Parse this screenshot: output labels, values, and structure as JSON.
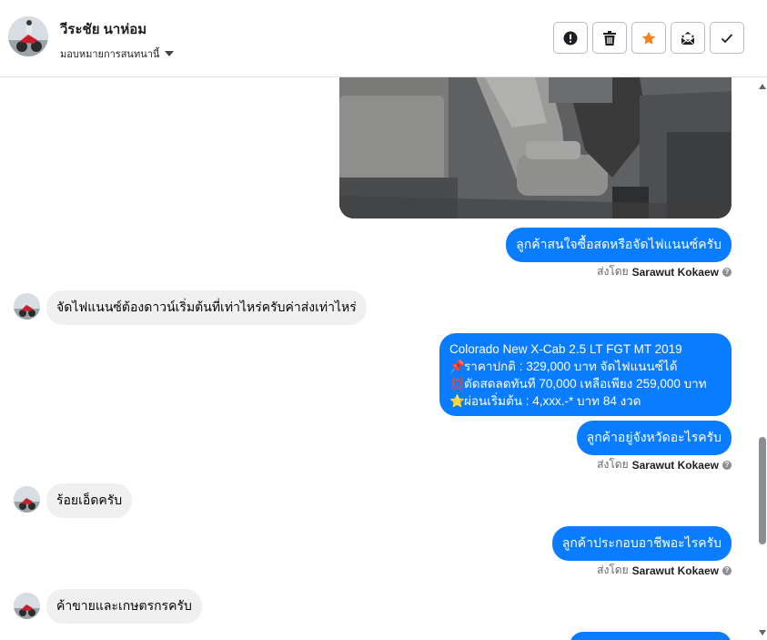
{
  "header": {
    "contact_name": "วีระชัย นาห่อม",
    "assign_label": "มอบหมายการสนทนานี้",
    "actions": [
      {
        "name": "report-button",
        "icon": "exclamation-circle-icon"
      },
      {
        "name": "delete-button",
        "icon": "trash-icon"
      },
      {
        "name": "star-button",
        "icon": "star-icon"
      },
      {
        "name": "mark-unread-button",
        "icon": "envelope-icon"
      },
      {
        "name": "mark-done-button",
        "icon": "check-icon"
      }
    ]
  },
  "colors": {
    "accent_blue": "#0a7cff",
    "star_orange": "#f5821f",
    "incoming_bubble": "#f0f0f0"
  },
  "messages": {
    "m1": {
      "text": "ลูกค้าสนใจซื้อสดหรือจัดไฟแนนซ์ครับ"
    },
    "sent1": {
      "prefix": "ส่งโดย",
      "name": "Sarawut Kokaew"
    },
    "m2": {
      "text": "จัดไฟแนนซ์ต้องดาวน์เริ่มต้นที่เท่าไหร่ครับค่าส่งเท่าไหร่"
    },
    "m3": {
      "line1": "Colorado New X-Cab 2.5 LT FGT MT 2019",
      "line2": "ราคาปกติ : 329,000 บาท จัดไฟแนนซ์ได้",
      "line3": "ตัดสดลดทันที 70,000 เหลือเพียง 259,000 บาท",
      "line4": "ผ่อนเริ่มต้น : 4,xxx.-* บาท 84 งวด",
      "emoji1": "📌",
      "emoji2": "💢",
      "emoji3": "⭐"
    },
    "m4": {
      "text": "ลูกค้าอยู่จังหวัดอะไรครับ"
    },
    "sent2": {
      "prefix": "ส่งโดย",
      "name": "Sarawut Kokaew"
    },
    "m5": {
      "text": "ร้อยเอ็ดครับ"
    },
    "m6": {
      "text": "ลูกค้าประกอบอาชีพอะไรครับ"
    },
    "sent3": {
      "prefix": "ส่งโดย",
      "name": "Sarawut Kokaew"
    },
    "m7": {
      "text": "ค้าขายและเกษตรกรครับ"
    }
  }
}
